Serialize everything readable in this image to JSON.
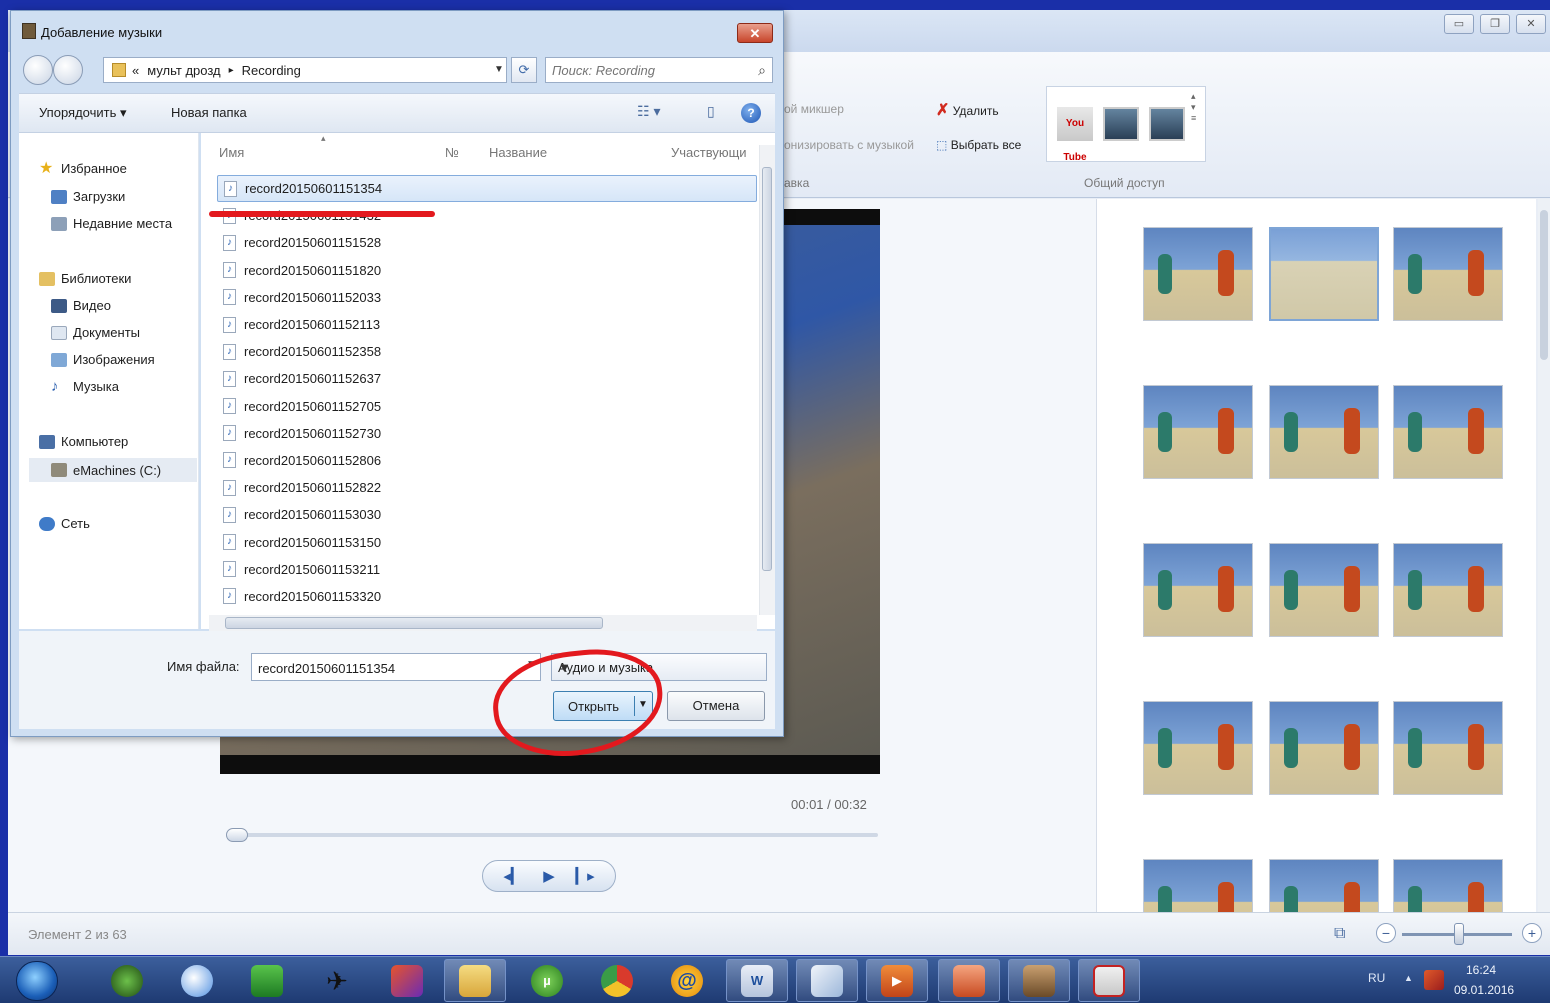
{
  "dialog": {
    "title": "Добавление музыки",
    "close_glyph": "✕",
    "address": {
      "root_glyph": "«",
      "crumbs": [
        "мульт дрозд",
        "Recording"
      ],
      "sep_glyph": "▸"
    },
    "search_placeholder": "Поиск: Recording",
    "toolbar": {
      "organize": "Упорядочить ▾",
      "new_folder": "Новая папка"
    },
    "nav": {
      "favorites": "Избранное",
      "downloads": "Загрузки",
      "recent": "Недавние места",
      "libraries": "Библиотеки",
      "video": "Видео",
      "documents": "Документы",
      "images": "Изображения",
      "music": "Музыка",
      "computer": "Компьютер",
      "drive": "eMachines (C:)",
      "network": "Сеть"
    },
    "columns": {
      "name": "Имя",
      "number": "№",
      "title": "Название",
      "artists": "Участвующи"
    },
    "files": [
      "record20150601151354",
      "record20150601151432",
      "record20150601151528",
      "record20150601151820",
      "record20150601152033",
      "record20150601152113",
      "record20150601152358",
      "record20150601152637",
      "record20150601152705",
      "record20150601152730",
      "record20150601152806",
      "record20150601152822",
      "record20150601153030",
      "record20150601153150",
      "record20150601153211",
      "record20150601153320"
    ],
    "selected_file_index": 0,
    "filename_label": "Имя файла:",
    "filename_value": "record20150601151354",
    "filter_value": "Аудио и музыка",
    "open_label": "Открыть",
    "cancel_label": "Отмена"
  },
  "app": {
    "ribbon": {
      "mixer": "ой микшер",
      "sync_music": "онизировать с музыкой",
      "delete": "Удалить",
      "select_all": "Выбрать все",
      "group_edit": "авка",
      "group_share": "Общий доступ",
      "youtube": "You Tube"
    },
    "preview": {
      "time": "00:01 / 00:32",
      "prev_glyph": "◂▎",
      "play_glyph": "▶",
      "next_glyph": "▎▸"
    },
    "status": "Элемент 2 из 63",
    "storyboard_thumb_count": 15,
    "selected_thumb_index": 1
  },
  "taskbar": {
    "language": "RU",
    "time": "16:24",
    "date": "09.01.2016"
  },
  "colors": {
    "background": "#1a2fa8",
    "annotation_red": "#e3191e",
    "selection_blue": "#84acdd"
  }
}
